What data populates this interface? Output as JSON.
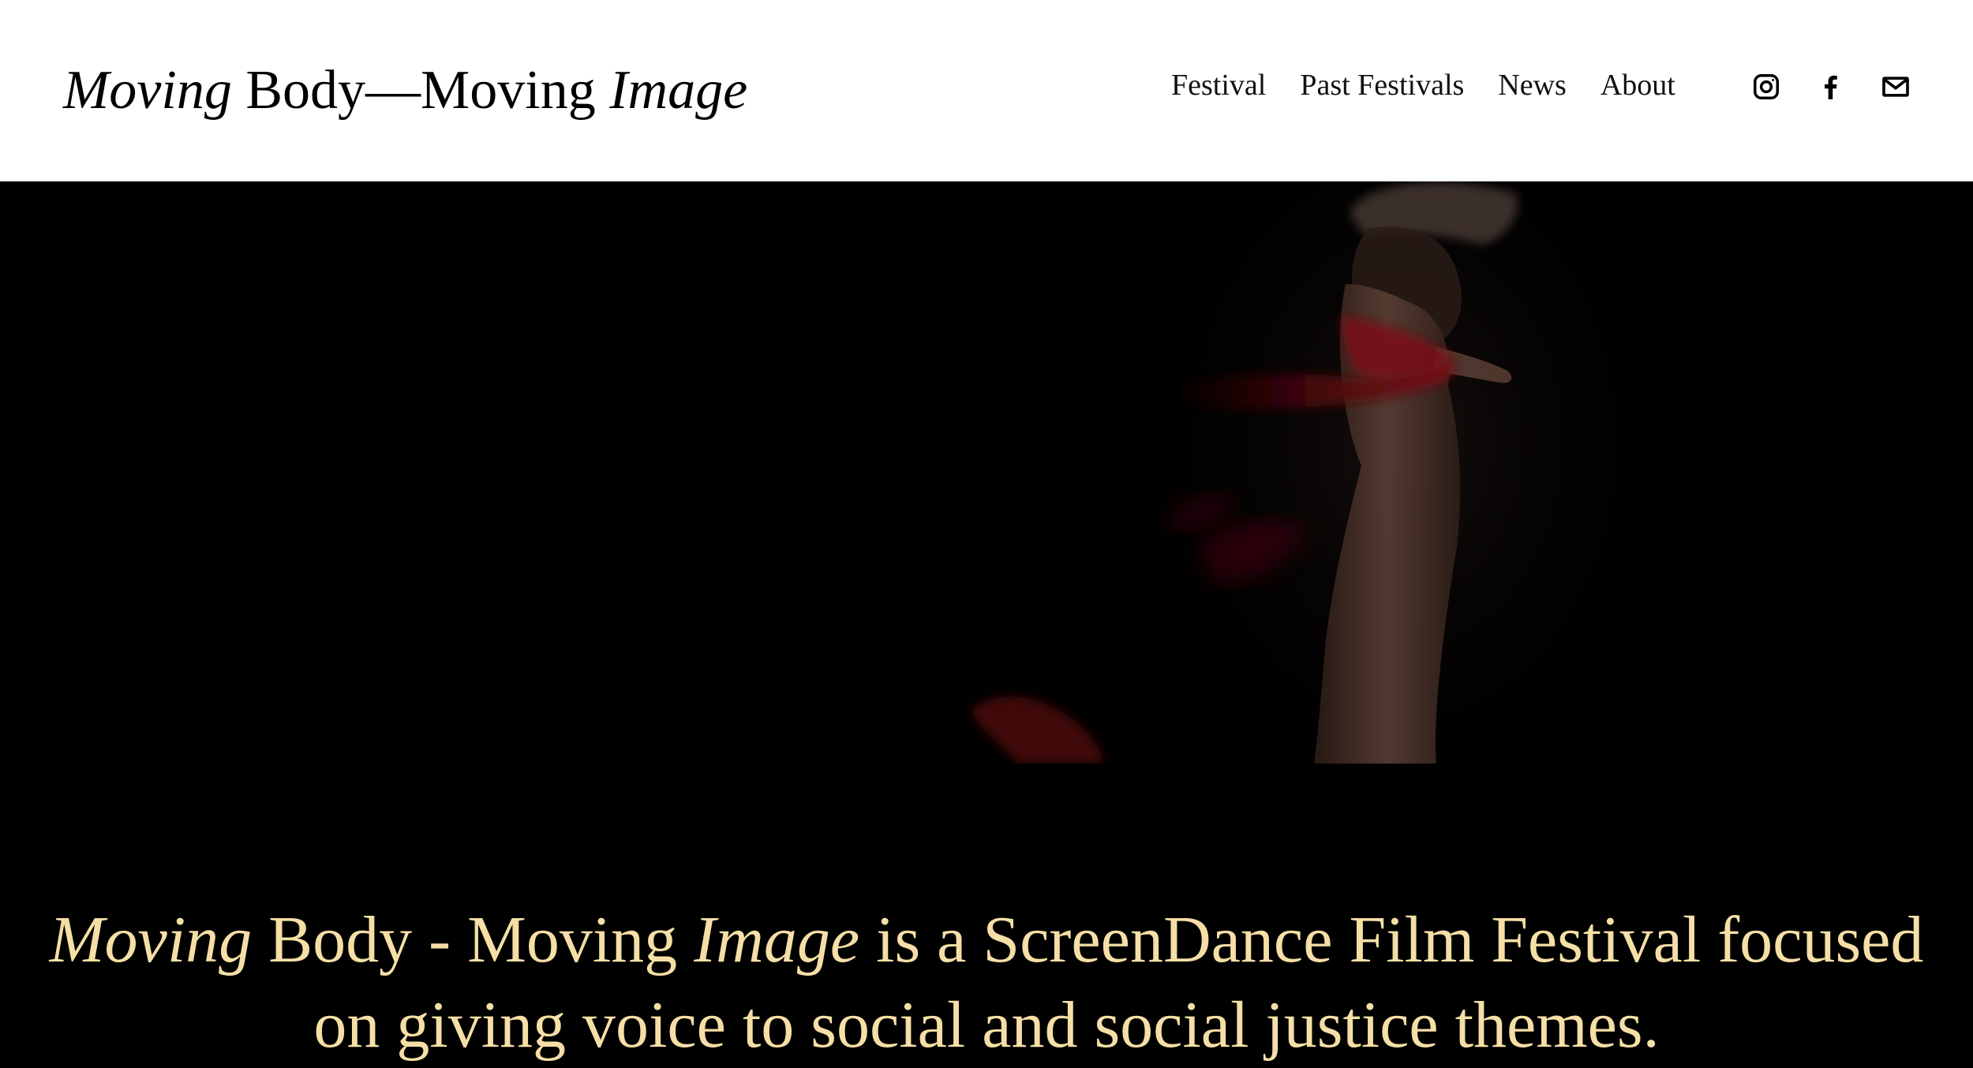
{
  "header": {
    "title_part1": "Moving",
    "title_part2": " Body—Moving ",
    "title_part3": "Image",
    "nav": [
      {
        "label": "Festival"
      },
      {
        "label": "Past Festivals"
      },
      {
        "label": "News"
      },
      {
        "label": "About"
      }
    ],
    "social": [
      {
        "icon": "instagram-icon"
      },
      {
        "icon": "facebook-icon"
      },
      {
        "icon": "email-icon"
      }
    ]
  },
  "hero": {
    "image": "dancer-with-red-fabric-photo"
  },
  "tagline": {
    "part1": "Moving",
    "part2": " Body - Moving ",
    "part3": "Image",
    "part4": " is a ScreenDance Film Festival focused on giving voice to social and social justice themes."
  },
  "colors": {
    "header_bg": "#ffffff",
    "hero_bg": "#000000",
    "tagline_text": "#f6dfa6",
    "fabric_red": "#6e0b12"
  }
}
